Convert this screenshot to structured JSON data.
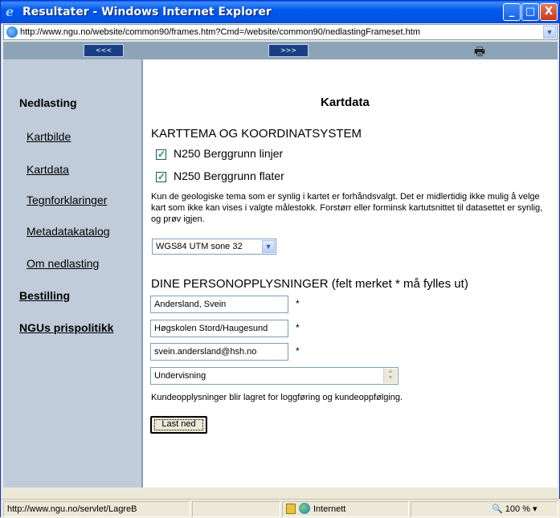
{
  "window": {
    "title": "Resultater - Windows Internet Explorer",
    "minimize": "_",
    "maximize": "□",
    "close": "X"
  },
  "address": {
    "url": "http://www.ngu.no/website/common90/frames.htm?Cmd=/website/common90/nedlastingFrameset.htm"
  },
  "toolbar": {
    "back_label": "<<<",
    "forward_label": ">>>"
  },
  "sidebar": {
    "heading": "Nedlasting",
    "links": [
      "Kartbilde",
      "Kartdata",
      "Tegnforklaringer",
      "Metadatakatalog",
      "Om nedlasting"
    ],
    "bestilling": "Bestilling",
    "prispolitikk": "NGUs prispolitikk"
  },
  "main": {
    "title": "Kartdata",
    "section1": "KARTTEMA OG KOORDINATSYSTEM",
    "layers": [
      {
        "label": "N250 Berggrunn linjer",
        "checked": true
      },
      {
        "label": "N250 Berggrunn flater",
        "checked": true
      }
    ],
    "info": "Kun de geologiske tema som er synlig i kartet er forhåndsvalgt. Det er midlertidig ikke mulig å velge kart som ikke kan vises i valgte målestokk. Forstørr eller forminsk kartutsnittet til datasettet er synlig, og prøv igjen.",
    "coordsys": "WGS84 UTM sone 32",
    "section2": "DINE PERSONOPPLYSNINGER (felt merket * må fylles ut)",
    "name": "Andersland, Svein",
    "organisation": "Høgskolen Stord/Haugesund",
    "email": "svein.andersland@hsh.no",
    "required_marker": "*",
    "purpose": "Undervisning",
    "note": "Kundeopplysninger blir lagret for loggføring og kundeoppfølging.",
    "submit": "Last ned"
  },
  "status": {
    "url": "http://www.ngu.no/servlet/LagreB",
    "zone": "Internett",
    "zoom": "100 %"
  }
}
